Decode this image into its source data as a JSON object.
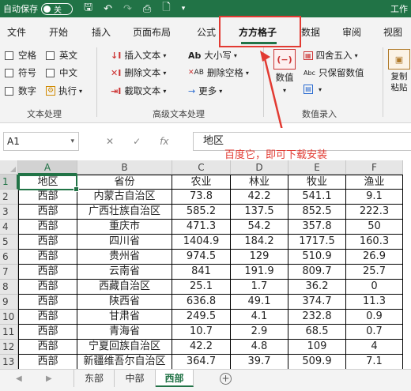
{
  "titlebar": {
    "autosave_label": "自动保存",
    "toggle_label": "关",
    "window_title": "工作"
  },
  "tabs": [
    "文件",
    "开始",
    "插入",
    "页面布局",
    "公式",
    "方方格子",
    "数据",
    "审阅",
    "视图"
  ],
  "active_tab": "方方格子",
  "ribbon": {
    "text_process": {
      "checkboxes": [
        "空格",
        "英文",
        "符号",
        "中文",
        "数字"
      ],
      "exec_label": "执行",
      "group_label": "文本处理"
    },
    "advanced_text": {
      "insert_text": "插入文本",
      "delete_text": "删除文本",
      "cut_text": "截取文本",
      "case_label": "大小写",
      "delete_space": "删除空格",
      "more_label": "更多",
      "group_label": "高级文本处理"
    },
    "number_entry": {
      "number_label": "数值",
      "round_label": "四舍五入",
      "keep_value_label": "只保留数值",
      "calc_label": "",
      "group_label": "数值录入",
      "copy_paste_label": "复制粘贴"
    }
  },
  "formula_bar": {
    "name_box": "A1",
    "fx_label": "fx",
    "content": "地区"
  },
  "annotation": "百度它，即可下载安装",
  "grid": {
    "columns": [
      "A",
      "B",
      "C",
      "D",
      "E",
      "F"
    ],
    "header_row": [
      "地区",
      "省份",
      "农业",
      "林业",
      "牧业",
      "渔业"
    ],
    "rows": [
      [
        "西部",
        "内蒙古自治区",
        "73.8",
        "42.2",
        "541.1",
        "9.1"
      ],
      [
        "西部",
        "广西壮族自治区",
        "585.2",
        "137.5",
        "852.5",
        "222.3"
      ],
      [
        "西部",
        "重庆市",
        "471.3",
        "54.2",
        "357.8",
        "50"
      ],
      [
        "西部",
        "四川省",
        "1404.9",
        "184.2",
        "1717.5",
        "160.3"
      ],
      [
        "西部",
        "贵州省",
        "974.5",
        "129",
        "510.9",
        "26.9"
      ],
      [
        "西部",
        "云南省",
        "841",
        "191.9",
        "809.7",
        "25.7"
      ],
      [
        "西部",
        "西藏自治区",
        "25.1",
        "1.7",
        "36.2",
        "0"
      ],
      [
        "西部",
        "陕西省",
        "636.8",
        "49.1",
        "374.7",
        "11.3"
      ],
      [
        "西部",
        "甘肃省",
        "249.5",
        "4.1",
        "232.8",
        "0.9"
      ],
      [
        "西部",
        "青海省",
        "10.7",
        "2.9",
        "68.5",
        "0.7"
      ],
      [
        "西部",
        "宁夏回族自治区",
        "42.2",
        "4.8",
        "109",
        "4"
      ],
      [
        "西部",
        "新疆维吾尔自治区",
        "364.7",
        "39.7",
        "509.9",
        "7.1"
      ]
    ],
    "row_numbers": [
      "1",
      "2",
      "3",
      "4",
      "5",
      "6",
      "7",
      "8",
      "9",
      "10",
      "11",
      "12",
      "13"
    ]
  },
  "sheets": [
    "东部",
    "中部",
    "西部"
  ],
  "active_sheet": "西部",
  "colors": {
    "accent": "#217346",
    "annotation": "#e23a32"
  }
}
